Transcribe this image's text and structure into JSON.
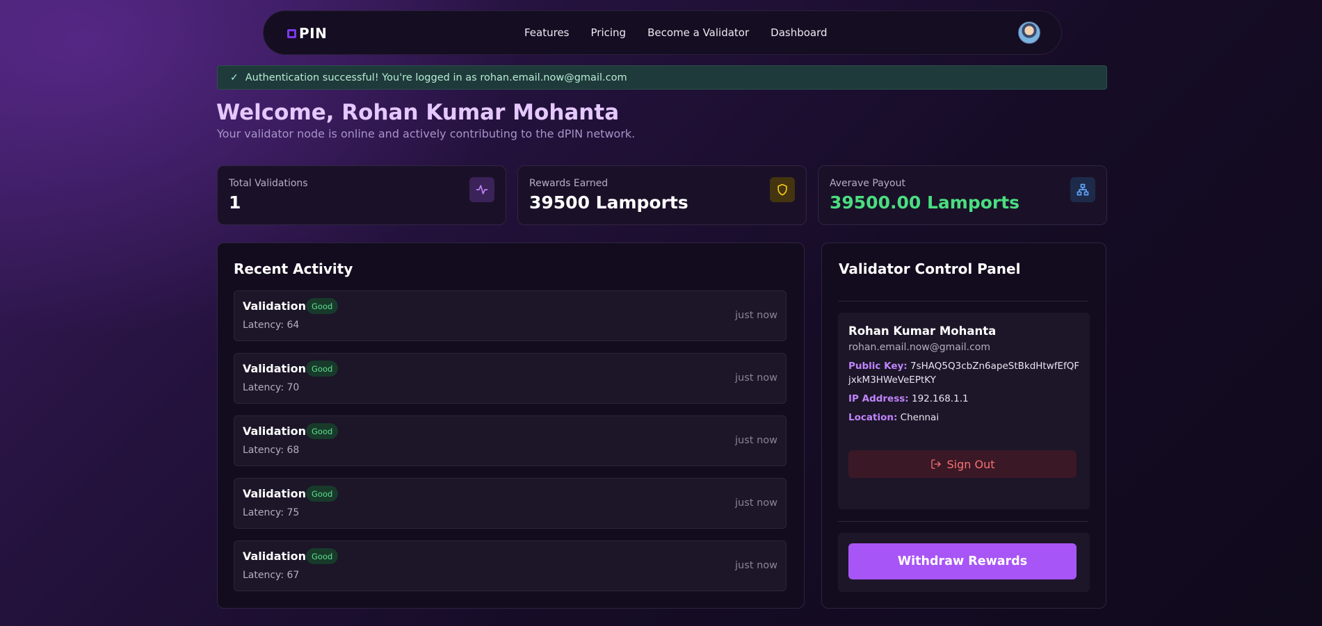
{
  "nav": {
    "brand": "PIN",
    "links": [
      "Features",
      "Pricing",
      "Become a Validator",
      "Dashboard"
    ]
  },
  "alert": {
    "icon": "check-icon",
    "message": "Authentication successful! You're logged in as rohan.email.now@gmail.com"
  },
  "welcome": {
    "title": "Welcome, Rohan Kumar Mohanta",
    "subtitle": "Your validator node is online and actively contributing to the dPIN network."
  },
  "stats": [
    {
      "label": "Total Validations",
      "value": "1",
      "icon": "activity-icon",
      "accent": "#a855f7"
    },
    {
      "label": "Rewards Earned",
      "value": "39500 Lamports",
      "icon": "shield-icon",
      "accent": "#eab308"
    },
    {
      "label": "Averave Payout",
      "value": "39500.00 Lamports",
      "icon": "network-icon",
      "accent": "#60a5fa"
    }
  ],
  "activity": {
    "title": "Recent Activity",
    "items": [
      {
        "name": "Validation",
        "status": "Good",
        "latency": "Latency: 64",
        "time": "just now"
      },
      {
        "name": "Validation",
        "status": "Good",
        "latency": "Latency: 70",
        "time": "just now"
      },
      {
        "name": "Validation",
        "status": "Good",
        "latency": "Latency: 68",
        "time": "just now"
      },
      {
        "name": "Validation",
        "status": "Good",
        "latency": "Latency: 75",
        "time": "just now"
      },
      {
        "name": "Validation",
        "status": "Good",
        "latency": "Latency: 67",
        "time": "just now"
      }
    ]
  },
  "control": {
    "title": "Validator Control Panel",
    "name": "Rohan Kumar Mohanta",
    "email": "rohan.email.now@gmail.com",
    "public_key_label": "Public Key:",
    "public_key": "7sHAQ5Q3cbZn6apeStBkdHtwfEfQFjxkM3HWeVeEPtKY",
    "ip_label": "IP Address:",
    "ip": "192.168.1.1",
    "location_label": "Location:",
    "location": "Chennai",
    "signout_label": "Sign Out",
    "withdraw_label": "Withdraw Rewards"
  }
}
